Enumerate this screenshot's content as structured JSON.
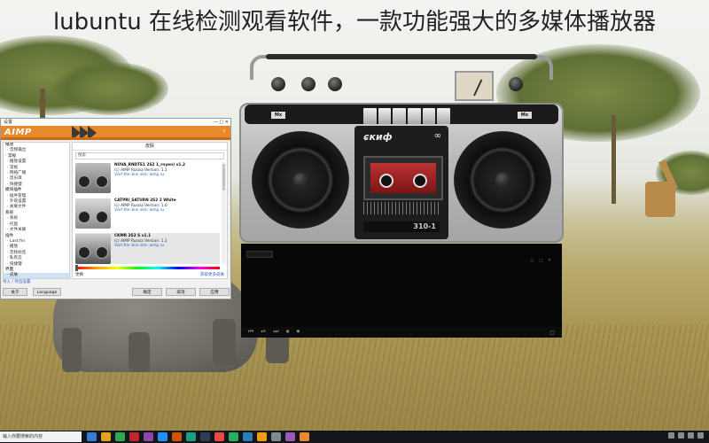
{
  "page_heading": "lubuntu 在线检测观看软件，一款功能强大的多媒体播放器",
  "aimp": {
    "window_title": "设置",
    "window_controls": "— □ ✕",
    "logo": "AIMP",
    "help": "?",
    "tree": [
      {
        "label": "播放",
        "group": true
      },
      {
        "label": "· 音频输出"
      },
      {
        "label": "· 常规",
        "group": true
      },
      {
        "label": "· 播放设置"
      },
      {
        "label": "· 常规"
      },
      {
        "label": "· 网络广播"
      },
      {
        "label": "· 音乐库"
      },
      {
        "label": "· 快捷键"
      },
      {
        "label": "模块插件",
        "group": true
      },
      {
        "label": "· 插件管理"
      },
      {
        "label": "· 外观设置"
      },
      {
        "label": "· 关联文件"
      },
      {
        "label": "系统",
        "group": true
      },
      {
        "label": "· 系统"
      },
      {
        "label": "· 托盘"
      },
      {
        "label": "· 文件关联"
      },
      {
        "label": "插件",
        "group": true
      },
      {
        "label": "· Last.fm"
      },
      {
        "label": "· 播放"
      },
      {
        "label": "· 音频标签"
      },
      {
        "label": "· 私有云"
      },
      {
        "label": "· 快捷键"
      },
      {
        "label": "界面",
        "group": true
      },
      {
        "label": "· 皮肤",
        "selected": true
      },
      {
        "label": "· 语言"
      }
    ],
    "panel_title": "皮肤",
    "search_placeholder": "搜索",
    "skins": [
      {
        "name": "NOVA_RNDTE1 2S2 1_rnyen) v1.2",
        "author": "(c) AIMP Russia Version: 1.1",
        "link": "Visit the skin site: aimp.ru"
      },
      {
        "name": "CATPRI_SATURN 2S2 2 White",
        "author": "(c) AIMP Russia Version: 1.0",
        "link": "Visit the skin site: aimp.ru"
      },
      {
        "name": "CKMR 2S2 S v1.1",
        "author": "(c) AIMP Russia Version: 1.1",
        "link": "Visit the skin site: aimp.ru"
      }
    ],
    "panel_footer_left": "更换",
    "panel_footer_right": "获取更多皮肤",
    "footer_link": "导入 / 导出设置",
    "buttons": {
      "about": "关于",
      "language": "Language",
      "ok": "确定",
      "cancel": "取消",
      "apply": "应用"
    }
  },
  "boombox": {
    "mx_left": "Mx",
    "mx_right": "Mx",
    "brand": "ɕкиф",
    "brand_symbol": "∞",
    "model": "310-1"
  },
  "viz": {
    "title": "",
    "icons": "◻ ◻ ✕",
    "controls": "⏮ ⏯ ⏭ ⏹ ⏺",
    "right": "◻"
  },
  "taskbar": {
    "search_placeholder": "输入你要搜索的内容"
  },
  "colors": {
    "aimp_accent": "#e88a2b",
    "taskbar": "#15161c"
  }
}
